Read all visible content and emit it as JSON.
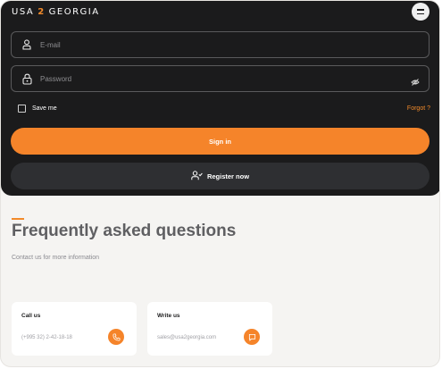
{
  "header": {
    "logo_prefix": "USA",
    "logo_number": "2",
    "logo_suffix": "GEORGIA",
    "menu_icon": "hamburger-icon"
  },
  "login": {
    "email_placeholder": "E-mail",
    "email_icon": "user-icon",
    "password_placeholder": "Password",
    "password_icon": "lock-icon",
    "visibility_icon": "eye-off-icon",
    "remember_label": "Save me",
    "forgot_label": "Forgot ?",
    "signin_label": "Sign in",
    "register_label": "Register now",
    "register_icon": "user-check-icon"
  },
  "faq": {
    "title": "Frequently asked questions",
    "subtitle": "Contact us for more information"
  },
  "contacts": [
    {
      "title": "Call us",
      "value": "(+995 32) 2-42-18-18",
      "icon": "phone-icon"
    },
    {
      "title": "Write us",
      "value": "sales@usa2georgia.com",
      "icon": "chat-icon"
    }
  ],
  "colors": {
    "accent": "#f5842a",
    "panel": "#1b1b1c",
    "page": "#f5f4f2"
  }
}
